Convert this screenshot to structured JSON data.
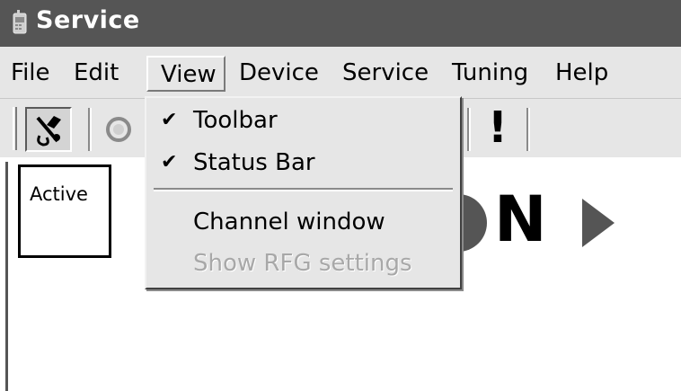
{
  "window": {
    "title": "Service",
    "icon": "app-icon"
  },
  "menubar": {
    "items": [
      {
        "label": "File"
      },
      {
        "label": "Edit"
      },
      {
        "label": "View"
      },
      {
        "label": "Device"
      },
      {
        "label": "Service"
      },
      {
        "label": "Tuning"
      },
      {
        "label": "Help"
      }
    ],
    "active": "View"
  },
  "view_menu": {
    "items": [
      {
        "label": "Toolbar",
        "checked": true
      },
      {
        "label": "Status Bar",
        "checked": true
      },
      {
        "label": "Channel window",
        "checked": false
      },
      {
        "label": "Show RFG settings",
        "checked": false,
        "disabled": true
      }
    ],
    "check_glyph": "✔"
  },
  "toolbar": {
    "buttons": [
      "tool-icon",
      "circle-icon",
      "exclamation-icon"
    ],
    "exclamation_glyph": "!"
  },
  "content": {
    "active_label": "Active",
    "logo_letter": "N",
    "logo_colors": {
      "circle": "#555555",
      "letter": "#000000",
      "arrow": "#555555"
    }
  },
  "colors": {
    "titlebar": "#555555",
    "menubar": "#e6e6e6",
    "disabled_text": "#a8a8a8"
  }
}
